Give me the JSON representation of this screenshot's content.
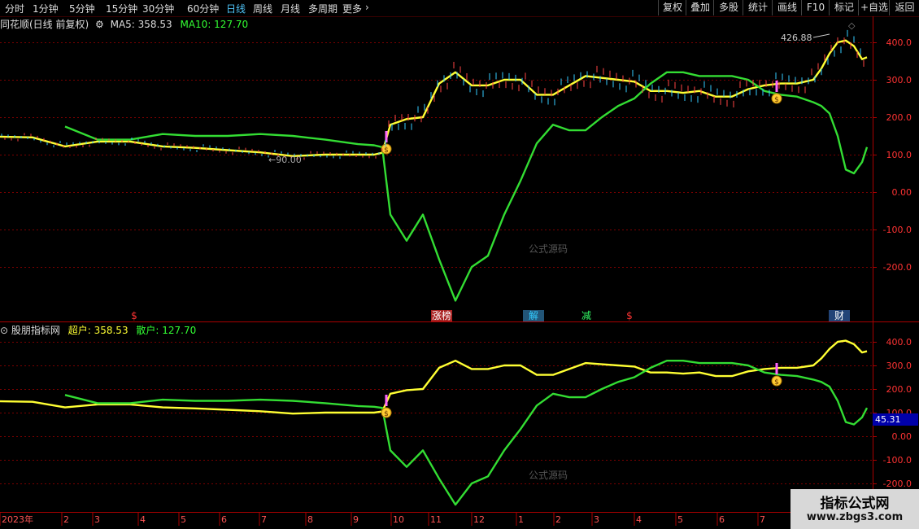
{
  "toolbar": {
    "periods": [
      "分时",
      "1分钟",
      "5分钟",
      "15分钟",
      "30分钟",
      "60分钟",
      "日线",
      "周线",
      "月线",
      "多周期",
      "更多"
    ],
    "active_period": "日线",
    "more_arrow": "›",
    "right_buttons": [
      "复权",
      "叠加",
      "多股",
      "统计",
      "画线",
      "F10",
      "标记",
      "+自选",
      "返回"
    ]
  },
  "main_panel": {
    "title": "同花顺(日线 前复权)",
    "ma5_label": "MA5: 358.53",
    "ma10_label": "MA10: 127.70",
    "price_max_label": "426.88",
    "price_min_label": "90.00",
    "axis_ticks": [
      "400.0",
      "300.0",
      "200.0",
      "100.0",
      "0.00",
      "-100.0",
      "-200.0"
    ],
    "watermark": "公式源码",
    "event_labels": [
      "$",
      "涨榜",
      "解",
      "减",
      "$",
      "财"
    ]
  },
  "sub_panel": {
    "title": "股朋指标网",
    "big_label": "超户: 358.53",
    "small_label": "散户: 127.70",
    "axis_ticks": [
      "400.0",
      "300.0",
      "200.0",
      "100.0",
      "0.00",
      "-100.0",
      "-200.0"
    ],
    "cursor_value": "45.31",
    "watermark": "公式源码"
  },
  "date_axis": {
    "labels": [
      "2023年",
      "2",
      "3",
      "4",
      "5",
      "6",
      "7",
      "8",
      "9",
      "10",
      "11",
      "12",
      "1",
      "2",
      "3",
      "4",
      "5",
      "6",
      "7"
    ]
  },
  "site_badge": {
    "title": "指标公式网",
    "url": "www.zbgs3.com"
  },
  "colors": {
    "yellow_line": "#ffff33",
    "green_line": "#33dd33",
    "grid": "#7a0000",
    "axis_text": "#ff3333"
  },
  "chart_data": [
    {
      "type": "line",
      "title": "同花顺(日线 前复权)",
      "x": [
        0,
        40,
        80,
        120,
        160,
        200,
        240,
        280,
        320,
        360,
        400,
        440,
        460,
        470,
        480,
        500,
        520,
        540,
        560,
        580,
        600,
        620,
        640,
        660,
        680,
        700,
        720,
        740,
        760,
        780,
        800,
        820,
        840,
        860,
        880,
        900,
        920,
        940,
        960,
        980,
        1000,
        1010,
        1020,
        1030,
        1040,
        1050,
        1060,
        1066
      ],
      "ylim": [
        -300,
        440
      ],
      "series": [
        {
          "name": "MA5",
          "values": [
            148,
            146,
            122,
            135,
            135,
            122,
            118,
            112,
            106,
            96,
            100,
            100,
            100,
            105,
            180,
            195,
            200,
            290,
            320,
            285,
            285,
            300,
            300,
            260,
            260,
            285,
            310,
            305,
            300,
            295,
            270,
            270,
            265,
            270,
            255,
            255,
            275,
            285,
            290,
            290,
            300,
            330,
            370,
            400,
            405,
            390,
            355,
            360
          ]
        },
        {
          "name": "MA10",
          "values": [
            null,
            null,
            175,
            140,
            140,
            155,
            150,
            150,
            155,
            150,
            140,
            128,
            125,
            120,
            -60,
            -130,
            -60,
            -180,
            -290,
            -200,
            -170,
            -60,
            30,
            130,
            180,
            165,
            165,
            200,
            230,
            250,
            290,
            320,
            320,
            310,
            310,
            310,
            300,
            270,
            260,
            255,
            240,
            230,
            210,
            150,
            60,
            50,
            80,
            120
          ]
        }
      ]
    },
    {
      "type": "line",
      "title": "股朋指标网",
      "x": [
        0,
        40,
        80,
        120,
        160,
        200,
        240,
        280,
        320,
        360,
        400,
        440,
        460,
        470,
        480,
        500,
        520,
        540,
        560,
        580,
        600,
        620,
        640,
        660,
        680,
        700,
        720,
        740,
        760,
        780,
        800,
        820,
        840,
        860,
        880,
        900,
        920,
        940,
        960,
        980,
        1000,
        1010,
        1020,
        1030,
        1040,
        1050,
        1060,
        1066
      ],
      "ylim": [
        -320,
        470
      ],
      "series": [
        {
          "name": "超户",
          "values": [
            148,
            146,
            122,
            135,
            135,
            122,
            118,
            112,
            106,
            96,
            100,
            100,
            100,
            105,
            180,
            195,
            200,
            290,
            320,
            285,
            285,
            300,
            300,
            260,
            260,
            285,
            310,
            305,
            300,
            295,
            270,
            270,
            265,
            270,
            255,
            255,
            275,
            285,
            290,
            290,
            300,
            330,
            370,
            400,
            405,
            390,
            355,
            360
          ]
        },
        {
          "name": "散户",
          "values": [
            null,
            null,
            175,
            140,
            140,
            155,
            150,
            150,
            155,
            150,
            140,
            128,
            125,
            120,
            -60,
            -130,
            -60,
            -180,
            -290,
            -200,
            -170,
            -60,
            30,
            130,
            180,
            165,
            165,
            200,
            230,
            250,
            290,
            320,
            320,
            310,
            310,
            310,
            300,
            270,
            260,
            255,
            240,
            230,
            210,
            150,
            60,
            50,
            80,
            120
          ]
        }
      ]
    }
  ]
}
